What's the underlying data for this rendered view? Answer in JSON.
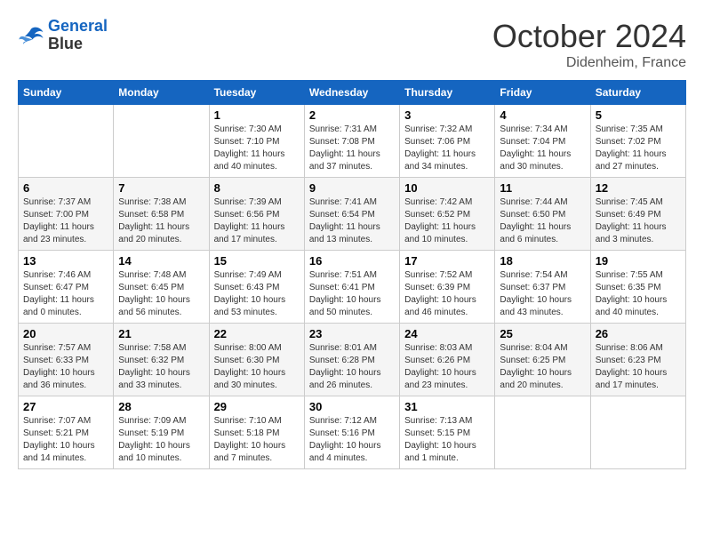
{
  "header": {
    "logo_line1": "General",
    "logo_line2": "Blue",
    "month": "October 2024",
    "location": "Didenheim, France"
  },
  "weekdays": [
    "Sunday",
    "Monday",
    "Tuesday",
    "Wednesday",
    "Thursday",
    "Friday",
    "Saturday"
  ],
  "weeks": [
    [
      {
        "day": "",
        "info": ""
      },
      {
        "day": "",
        "info": ""
      },
      {
        "day": "1",
        "info": "Sunrise: 7:30 AM\nSunset: 7:10 PM\nDaylight: 11 hours and 40 minutes."
      },
      {
        "day": "2",
        "info": "Sunrise: 7:31 AM\nSunset: 7:08 PM\nDaylight: 11 hours and 37 minutes."
      },
      {
        "day": "3",
        "info": "Sunrise: 7:32 AM\nSunset: 7:06 PM\nDaylight: 11 hours and 34 minutes."
      },
      {
        "day": "4",
        "info": "Sunrise: 7:34 AM\nSunset: 7:04 PM\nDaylight: 11 hours and 30 minutes."
      },
      {
        "day": "5",
        "info": "Sunrise: 7:35 AM\nSunset: 7:02 PM\nDaylight: 11 hours and 27 minutes."
      }
    ],
    [
      {
        "day": "6",
        "info": "Sunrise: 7:37 AM\nSunset: 7:00 PM\nDaylight: 11 hours and 23 minutes."
      },
      {
        "day": "7",
        "info": "Sunrise: 7:38 AM\nSunset: 6:58 PM\nDaylight: 11 hours and 20 minutes."
      },
      {
        "day": "8",
        "info": "Sunrise: 7:39 AM\nSunset: 6:56 PM\nDaylight: 11 hours and 17 minutes."
      },
      {
        "day": "9",
        "info": "Sunrise: 7:41 AM\nSunset: 6:54 PM\nDaylight: 11 hours and 13 minutes."
      },
      {
        "day": "10",
        "info": "Sunrise: 7:42 AM\nSunset: 6:52 PM\nDaylight: 11 hours and 10 minutes."
      },
      {
        "day": "11",
        "info": "Sunrise: 7:44 AM\nSunset: 6:50 PM\nDaylight: 11 hours and 6 minutes."
      },
      {
        "day": "12",
        "info": "Sunrise: 7:45 AM\nSunset: 6:49 PM\nDaylight: 11 hours and 3 minutes."
      }
    ],
    [
      {
        "day": "13",
        "info": "Sunrise: 7:46 AM\nSunset: 6:47 PM\nDaylight: 11 hours and 0 minutes."
      },
      {
        "day": "14",
        "info": "Sunrise: 7:48 AM\nSunset: 6:45 PM\nDaylight: 10 hours and 56 minutes."
      },
      {
        "day": "15",
        "info": "Sunrise: 7:49 AM\nSunset: 6:43 PM\nDaylight: 10 hours and 53 minutes."
      },
      {
        "day": "16",
        "info": "Sunrise: 7:51 AM\nSunset: 6:41 PM\nDaylight: 10 hours and 50 minutes."
      },
      {
        "day": "17",
        "info": "Sunrise: 7:52 AM\nSunset: 6:39 PM\nDaylight: 10 hours and 46 minutes."
      },
      {
        "day": "18",
        "info": "Sunrise: 7:54 AM\nSunset: 6:37 PM\nDaylight: 10 hours and 43 minutes."
      },
      {
        "day": "19",
        "info": "Sunrise: 7:55 AM\nSunset: 6:35 PM\nDaylight: 10 hours and 40 minutes."
      }
    ],
    [
      {
        "day": "20",
        "info": "Sunrise: 7:57 AM\nSunset: 6:33 PM\nDaylight: 10 hours and 36 minutes."
      },
      {
        "day": "21",
        "info": "Sunrise: 7:58 AM\nSunset: 6:32 PM\nDaylight: 10 hours and 33 minutes."
      },
      {
        "day": "22",
        "info": "Sunrise: 8:00 AM\nSunset: 6:30 PM\nDaylight: 10 hours and 30 minutes."
      },
      {
        "day": "23",
        "info": "Sunrise: 8:01 AM\nSunset: 6:28 PM\nDaylight: 10 hours and 26 minutes."
      },
      {
        "day": "24",
        "info": "Sunrise: 8:03 AM\nSunset: 6:26 PM\nDaylight: 10 hours and 23 minutes."
      },
      {
        "day": "25",
        "info": "Sunrise: 8:04 AM\nSunset: 6:25 PM\nDaylight: 10 hours and 20 minutes."
      },
      {
        "day": "26",
        "info": "Sunrise: 8:06 AM\nSunset: 6:23 PM\nDaylight: 10 hours and 17 minutes."
      }
    ],
    [
      {
        "day": "27",
        "info": "Sunrise: 7:07 AM\nSunset: 5:21 PM\nDaylight: 10 hours and 14 minutes."
      },
      {
        "day": "28",
        "info": "Sunrise: 7:09 AM\nSunset: 5:19 PM\nDaylight: 10 hours and 10 minutes."
      },
      {
        "day": "29",
        "info": "Sunrise: 7:10 AM\nSunset: 5:18 PM\nDaylight: 10 hours and 7 minutes."
      },
      {
        "day": "30",
        "info": "Sunrise: 7:12 AM\nSunset: 5:16 PM\nDaylight: 10 hours and 4 minutes."
      },
      {
        "day": "31",
        "info": "Sunrise: 7:13 AM\nSunset: 5:15 PM\nDaylight: 10 hours and 1 minute."
      },
      {
        "day": "",
        "info": ""
      },
      {
        "day": "",
        "info": ""
      }
    ]
  ]
}
